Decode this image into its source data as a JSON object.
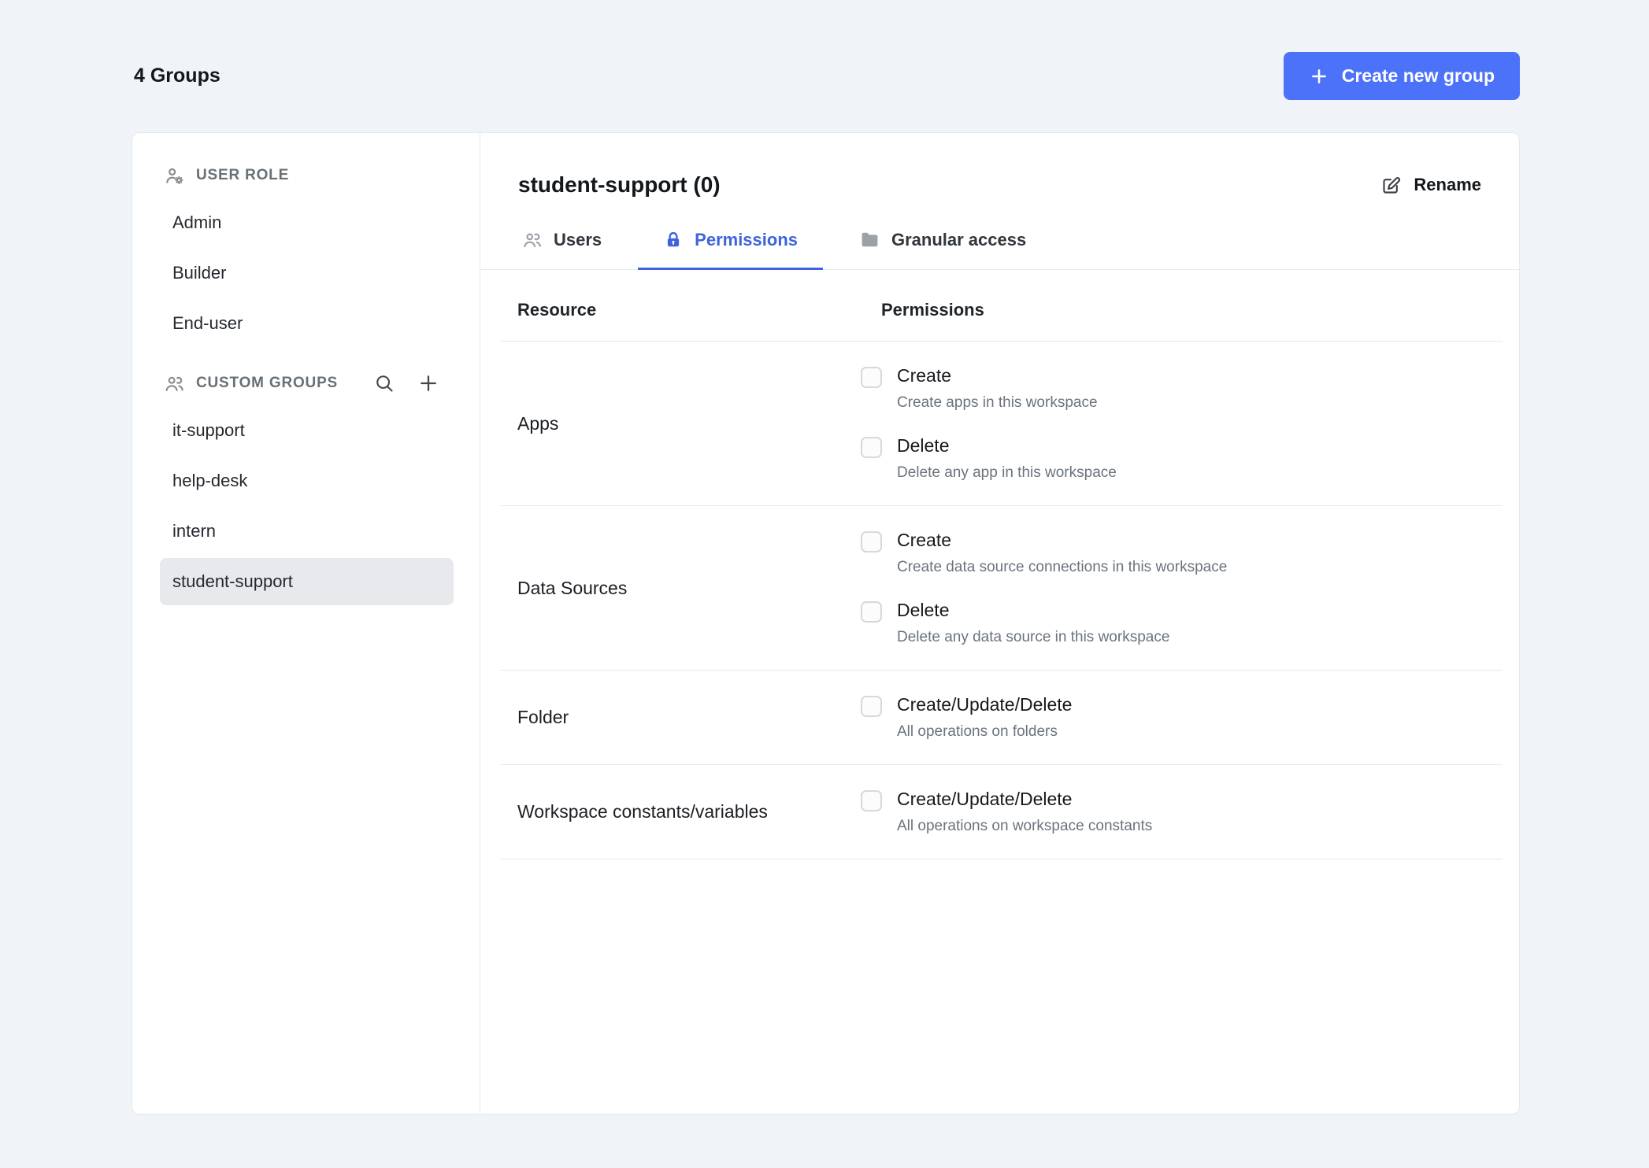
{
  "page": {
    "heading": "4 Groups",
    "create_group_button": "Create new group"
  },
  "sidebar": {
    "user_role": {
      "header": "USER ROLE",
      "items": [
        {
          "label": "Admin",
          "selected": false
        },
        {
          "label": "Builder",
          "selected": false
        },
        {
          "label": "End-user",
          "selected": false
        }
      ]
    },
    "custom_groups": {
      "header": "CUSTOM GROUPS",
      "items": [
        {
          "label": "it-support",
          "selected": false
        },
        {
          "label": "help-desk",
          "selected": false
        },
        {
          "label": "intern",
          "selected": false
        },
        {
          "label": "student-support",
          "selected": true
        }
      ]
    }
  },
  "content": {
    "group_title": "student-support (0)",
    "rename_label": "Rename",
    "tabs": [
      {
        "label": "Users",
        "active": false
      },
      {
        "label": "Permissions",
        "active": true
      },
      {
        "label": "Granular access",
        "active": false
      }
    ],
    "table": {
      "headers": {
        "resource": "Resource",
        "permissions": "Permissions"
      },
      "rows": [
        {
          "resource": "Apps",
          "permissions": [
            {
              "label": "Create",
              "description": "Create apps in this workspace",
              "checked": false
            },
            {
              "label": "Delete",
              "description": "Delete any app in this workspace",
              "checked": false
            }
          ]
        },
        {
          "resource": "Data Sources",
          "permissions": [
            {
              "label": "Create",
              "description": "Create data source connections in this workspace",
              "checked": false
            },
            {
              "label": "Delete",
              "description": "Delete any data source in this workspace",
              "checked": false
            }
          ]
        },
        {
          "resource": "Folder",
          "permissions": [
            {
              "label": "Create/Update/Delete",
              "description": "All operations on folders",
              "checked": false
            }
          ]
        },
        {
          "resource": "Workspace constants/variables",
          "permissions": [
            {
              "label": "Create/Update/Delete",
              "description": "All operations on workspace constants",
              "checked": false
            }
          ]
        }
      ]
    }
  },
  "icons": {
    "create-group": "plus",
    "user-role": "person-gear",
    "custom-groups": "people",
    "search": "magnifier",
    "add-group": "plus",
    "users-tab": "people",
    "permissions-tab": "lock",
    "granular-access-tab": "folder",
    "rename": "pencil"
  },
  "colors": {
    "primary_button": "#4d72fa",
    "active_tab": "#3e63dd",
    "page_background": "#f0f4f8",
    "selected_item_background": "#e7e9ed",
    "divider": "#e7eaee"
  }
}
